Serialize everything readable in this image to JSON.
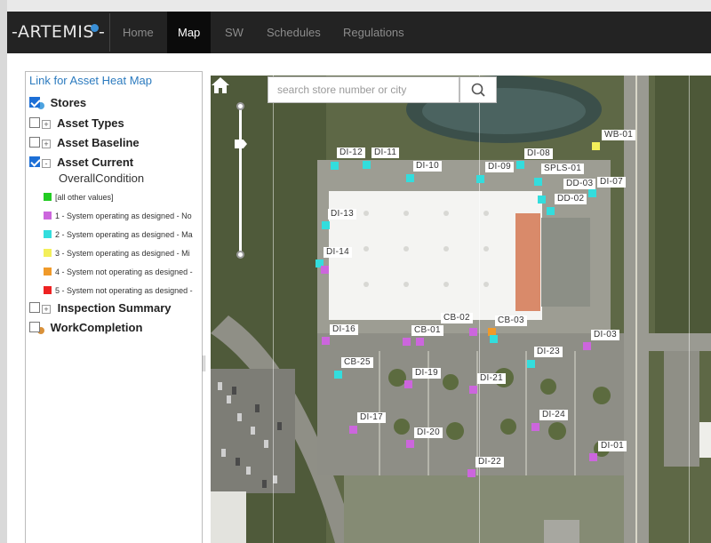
{
  "app": {
    "logo_text": "ARTEMIS"
  },
  "nav": {
    "items": [
      {
        "label": "Home",
        "active": false
      },
      {
        "label": "Map",
        "active": true
      },
      {
        "label": "SW",
        "active": false
      },
      {
        "label": "Schedules",
        "active": false
      },
      {
        "label": "Regulations",
        "active": false
      }
    ]
  },
  "sidebar": {
    "heat_map_link": "Link for Asset Heat Map",
    "layers": [
      {
        "label": "Stores",
        "checked": true,
        "expander": false,
        "dot_color": "#4da3e0"
      },
      {
        "label": "Asset Types",
        "checked": false,
        "expander": "+"
      },
      {
        "label": "Asset Baseline",
        "checked": false,
        "expander": "+"
      },
      {
        "label": "Asset Current",
        "checked": true,
        "expander": "-"
      },
      {
        "label": "Inspection Summary",
        "checked": false,
        "expander": "+"
      },
      {
        "label": "WorkCompletion",
        "checked": false,
        "expander": false,
        "dot_color": "#d9913a"
      }
    ],
    "asset_current_field": "OverallCondition",
    "legend": [
      {
        "label": "[all other values]",
        "color": "#22cc22"
      },
      {
        "label": "1 - System operating as designed - No",
        "color": "#cc66dd"
      },
      {
        "label": "2 - System operating as designed - Ma",
        "color": "#33dddd"
      },
      {
        "label": "3 - System operating as designed - Mi",
        "color": "#f3ef5a"
      },
      {
        "label": "4 - System not operating as designed -",
        "color": "#f09a2a"
      },
      {
        "label": "5 - System not operating as designed -",
        "color": "#ee2222"
      }
    ]
  },
  "map": {
    "search_placeholder": "search store number or city",
    "assets": [
      {
        "label": "WB-01",
        "color": "#f3ef5a"
      },
      {
        "label": "DI-12",
        "color": "#33dddd"
      },
      {
        "label": "DI-11",
        "color": "#33dddd"
      },
      {
        "label": "DI-08",
        "color": "#33dddd"
      },
      {
        "label": "DI-10",
        "color": "#33dddd"
      },
      {
        "label": "DI-09",
        "color": "#33dddd"
      },
      {
        "label": "SPLS-01",
        "color": "#33dddd"
      },
      {
        "label": "DD-03",
        "color": "#33dddd"
      },
      {
        "label": "DI-07",
        "color": "#33dddd"
      },
      {
        "label": "DD-02",
        "color": "#33dddd"
      },
      {
        "label": "DI-13",
        "color": "#33dddd"
      },
      {
        "label": "DI-14",
        "color": "#cc66dd"
      },
      {
        "label": "CB-02",
        "color": "#cc66dd"
      },
      {
        "label": "CB-03",
        "color": "#f09a2a"
      },
      {
        "label": "DI-16",
        "color": "#cc66dd"
      },
      {
        "label": "CB-01",
        "color": "#cc66dd"
      },
      {
        "label": "DI-03",
        "color": "#cc66dd"
      },
      {
        "label": "DI-23",
        "color": "#33dddd"
      },
      {
        "label": "CB-25",
        "color": "#33dddd"
      },
      {
        "label": "DI-19",
        "color": "#cc66dd"
      },
      {
        "label": "DI-21",
        "color": "#cc66dd"
      },
      {
        "label": "DI-17",
        "color": "#cc66dd"
      },
      {
        "label": "DI-24",
        "color": "#cc66dd"
      },
      {
        "label": "DI-20",
        "color": "#cc66dd"
      },
      {
        "label": "DI-01",
        "color": "#cc66dd"
      },
      {
        "label": "DI-22",
        "color": "#cc66dd"
      }
    ]
  }
}
